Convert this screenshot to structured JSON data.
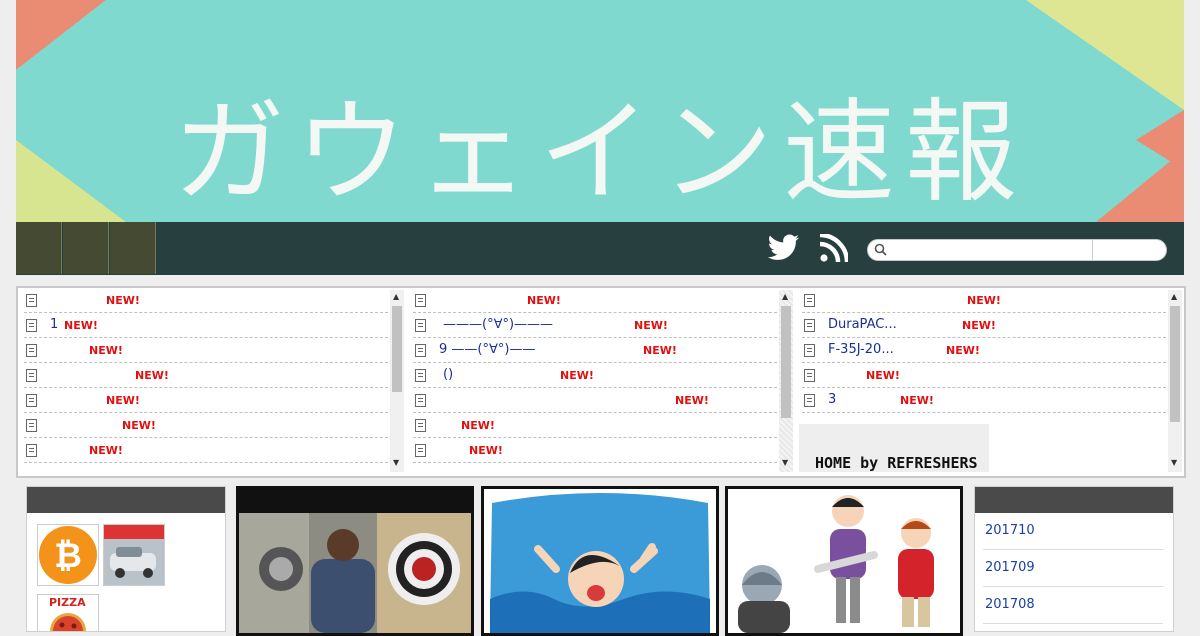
{
  "site": {
    "title": "ガウェイン速報"
  },
  "nav": {
    "icons": [
      "twitter-icon",
      "rss-icon"
    ],
    "search": {
      "placeholder": "",
      "value": ""
    }
  },
  "antenna": {
    "col1": [
      {
        "title": "",
        "badge": "NEW!"
      },
      {
        "title": "1",
        "badge": "NEW!"
      },
      {
        "title": "",
        "badge": "NEW!"
      },
      {
        "title": "",
        "badge": "NEW!"
      },
      {
        "title": "",
        "badge": "NEW!"
      },
      {
        "title": "",
        "badge": "NEW!"
      },
      {
        "title": "",
        "badge": "NEW!"
      }
    ],
    "col2": [
      {
        "title": "",
        "badge": "NEW!"
      },
      {
        "title": "———(°∀°)———",
        "badge": "NEW!"
      },
      {
        "title": "9 ——(°∀°)——",
        "badge": "NEW!"
      },
      {
        "title": "()",
        "badge": "NEW!"
      },
      {
        "title": "",
        "badge": "NEW!"
      },
      {
        "title": "",
        "badge": "NEW!"
      },
      {
        "title": "",
        "badge": "NEW!"
      }
    ],
    "col3": [
      {
        "title": "",
        "badge": "NEW!"
      },
      {
        "title": "DuraPAC...",
        "badge": "NEW!"
      },
      {
        "title": "F-35J-20...",
        "badge": "NEW!"
      },
      {
        "title": "",
        "badge": "NEW!"
      },
      {
        "title": "3",
        "badge": "NEW!"
      }
    ],
    "home_banner": "HOME by REFRESHERS"
  },
  "left_panel": {
    "thumbnails": [
      "bitcoin-thumb",
      "car-thumb",
      "pizza-thumb"
    ],
    "pizza_label": "PIZZA"
  },
  "features": [
    "axe-throwing-photo",
    "drowning-illustration",
    "bully-illustration"
  ],
  "archive": {
    "months": [
      "201710",
      "201709",
      "201708"
    ]
  },
  "colors": {
    "banner_bg": "#7fd9cf",
    "navbar": "#27403f",
    "new_badge": "#e30e0e",
    "link": "#1a2e99"
  }
}
